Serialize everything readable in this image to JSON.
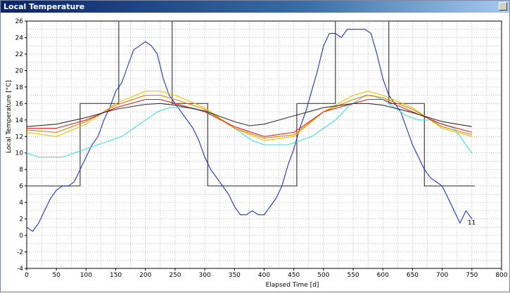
{
  "window": {
    "title": "Local Temperature"
  },
  "chart_data": {
    "type": "line",
    "title": "",
    "xlabel": "Elapsed Time [d]",
    "ylabel": "Local Temperature [°C]",
    "xlim": [
      0,
      800
    ],
    "ylim": [
      -4,
      26
    ],
    "xticks": [
      0,
      50,
      100,
      150,
      200,
      250,
      300,
      350,
      400,
      450,
      500,
      550,
      600,
      650,
      700,
      750,
      800
    ],
    "yticks": [
      -4,
      -2,
      0,
      2,
      4,
      6,
      8,
      10,
      12,
      14,
      16,
      18,
      20,
      22,
      24,
      26
    ],
    "grid": true,
    "series": [
      {
        "name": "",
        "label": "",
        "color": "#404040",
        "step": true,
        "x": [
          0,
          90,
          90,
          155,
          155,
          245,
          245,
          305,
          305,
          455,
          455,
          520,
          520,
          610,
          610,
          670,
          670,
          755
        ],
        "y": [
          6,
          6,
          16,
          16,
          26,
          26,
          16,
          16,
          6,
          6,
          16,
          16,
          26,
          26,
          16,
          16,
          6,
          6
        ]
      },
      {
        "name": "",
        "label": "11",
        "color": "#2030c0",
        "x": [
          0,
          10,
          20,
          30,
          40,
          50,
          60,
          70,
          80,
          90,
          100,
          110,
          120,
          130,
          140,
          150,
          160,
          170,
          180,
          190,
          200,
          210,
          220,
          230,
          240,
          250,
          260,
          270,
          280,
          290,
          300,
          310,
          320,
          330,
          340,
          350,
          360,
          370,
          380,
          390,
          400,
          410,
          420,
          430,
          440,
          450,
          460,
          470,
          480,
          490,
          500,
          510,
          520,
          530,
          540,
          550,
          560,
          570,
          580,
          590,
          600,
          610,
          620,
          630,
          640,
          650,
          660,
          670,
          680,
          690,
          700,
          710,
          720,
          730,
          740,
          750
        ],
        "y": [
          1,
          0.5,
          1.5,
          3,
          4.5,
          5.5,
          6,
          6,
          6.5,
          8,
          9.5,
          11,
          12,
          14,
          15.5,
          17.5,
          18.5,
          20.5,
          22.5,
          23,
          23.5,
          23,
          22,
          19,
          17,
          16,
          15,
          14,
          13,
          11.5,
          9.5,
          8,
          7,
          6,
          5,
          3.5,
          2.5,
          2.5,
          3,
          2.5,
          2.5,
          3.5,
          4.5,
          6,
          8.5,
          10.5,
          13,
          15,
          17.5,
          20,
          23,
          24.5,
          24.5,
          24,
          25,
          25,
          25,
          25,
          24.5,
          22,
          19,
          17,
          16,
          15,
          13,
          11,
          9.5,
          8,
          7,
          6.5,
          6,
          4.5,
          3,
          1.5,
          3,
          2
        ]
      },
      {
        "name": "",
        "label": "",
        "color": "#40e0e0",
        "x": [
          0,
          20,
          40,
          60,
          80,
          100,
          120,
          140,
          160,
          180,
          200,
          220,
          240,
          260,
          280,
          300,
          320,
          340,
          360,
          380,
          400,
          420,
          440,
          460,
          480,
          500,
          520,
          540,
          560,
          570,
          580,
          600,
          620,
          640,
          660,
          680,
          700,
          720,
          740,
          750
        ],
        "y": [
          10,
          9.5,
          9.5,
          9.5,
          10,
          10.5,
          11,
          11.5,
          12,
          13,
          14,
          15,
          15.5,
          15.5,
          15.5,
          15,
          14.5,
          13.5,
          12.5,
          11.5,
          11,
          11,
          11,
          11.5,
          12,
          13,
          14,
          15.5,
          16.5,
          17,
          17,
          16.5,
          15.5,
          14.5,
          14,
          14,
          13.5,
          13,
          11,
          10
        ]
      },
      {
        "name": "",
        "label": "",
        "color": "#e8c000",
        "x": [
          0,
          50,
          100,
          150,
          200,
          225,
          250,
          300,
          350,
          400,
          450,
          500,
          550,
          575,
          600,
          650,
          700,
          750
        ],
        "y": [
          12.5,
          12,
          13.5,
          16,
          17.5,
          17.5,
          17,
          15.5,
          13,
          11.5,
          12,
          15,
          17,
          17.5,
          17,
          15.5,
          13,
          12
        ]
      },
      {
        "name": "",
        "label": "",
        "color": "#e08000",
        "x": [
          0,
          50,
          100,
          150,
          200,
          225,
          250,
          300,
          350,
          400,
          450,
          500,
          550,
          575,
          600,
          650,
          700,
          750
        ],
        "y": [
          12.8,
          12.5,
          13.8,
          15.8,
          17,
          17,
          16.5,
          15.3,
          13,
          11.8,
          12.2,
          15,
          16.5,
          17,
          16.7,
          15.3,
          13.2,
          12.2
        ]
      },
      {
        "name": "",
        "label": "",
        "color": "#e02020",
        "x": [
          0,
          50,
          100,
          150,
          200,
          225,
          250,
          300,
          350,
          400,
          450,
          500,
          550,
          575,
          600,
          650,
          700,
          750
        ],
        "y": [
          13,
          13,
          14,
          15.5,
          16.5,
          16.5,
          16,
          15,
          13.2,
          12,
          12.5,
          15,
          16,
          16.5,
          16.5,
          15,
          13.5,
          12.5
        ]
      },
      {
        "name": "",
        "label": "",
        "color": "#303030",
        "x": [
          0,
          50,
          100,
          150,
          200,
          225,
          250,
          300,
          350,
          375,
          400,
          450,
          500,
          550,
          575,
          600,
          650,
          700,
          750
        ],
        "y": [
          13.2,
          13.5,
          14.3,
          15.3,
          15.9,
          16,
          15.8,
          15.1,
          13.8,
          13.3,
          13.5,
          14.5,
          15.5,
          16,
          16,
          15.8,
          14.9,
          13.8,
          13.2
        ]
      }
    ]
  }
}
